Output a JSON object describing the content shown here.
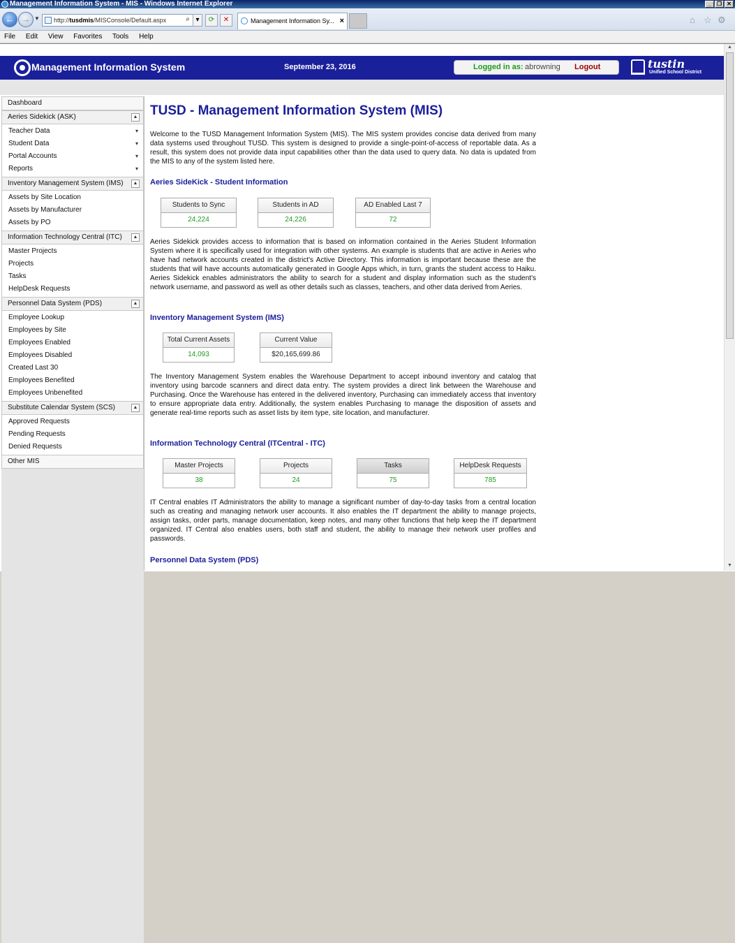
{
  "window": {
    "title": "Management Information System - MIS - Windows Internet Explorer",
    "url_prefix": "http://",
    "url_host": "tusdmis",
    "url_path": "/MISConsole/Default.aspx",
    "tab_title": "Management Information Sy...",
    "menu": [
      "File",
      "Edit",
      "View",
      "Favorites",
      "Tools",
      "Help"
    ]
  },
  "header": {
    "app_title": "Management Information System",
    "date": "September 23, 2016",
    "logged_in_label": "Logged in as:",
    "username": "abrowning",
    "logout": "Logout",
    "district_name": "tustin",
    "district_sub": "Unified School District"
  },
  "sidebar": {
    "dashboard": "Dashboard",
    "sections": [
      {
        "title": "Aeries Sidekick (ASK)",
        "items": [
          "Teacher Data",
          "Student Data",
          "Portal Accounts",
          "Reports"
        ]
      },
      {
        "title": "Inventory Management System (IMS)",
        "items": [
          "Assets by Site Location",
          "Assets by Manufacturer",
          "Assets by PO"
        ]
      },
      {
        "title": "Information Technology Central (ITC)",
        "items": [
          "Master Projects",
          "Projects",
          "Tasks",
          "HelpDesk Requests"
        ]
      },
      {
        "title": "Personnel Data System (PDS)",
        "items": [
          "Employee Lookup",
          "Employees by Site",
          "Employees Enabled",
          "Employees Disabled",
          "Created Last 30",
          "Employees Benefited",
          "Employees Unbenefited"
        ]
      },
      {
        "title": "Substitute Calendar System (SCS)",
        "items": [
          "Approved Requests",
          "Pending Requests",
          "Denied Requests"
        ]
      }
    ],
    "other": "Other MIS"
  },
  "main": {
    "title": "TUSD - Management Information System (MIS)",
    "intro": "Welcome to the TUSD Management Information System (MIS). The MIS system provides concise data derived from many data systems used throughout TUSD. This system is designed to provide a single-point-of-access of reportable data. As a result, this system does not provide data input capabilities other than the data used to query data. No data is updated from the MIS to any of the system listed here.",
    "ask": {
      "heading": "Aeries SideKick - Student Information",
      "stats": [
        {
          "label": "Students to Sync",
          "value": "24,224"
        },
        {
          "label": "Students in AD",
          "value": "24,226"
        },
        {
          "label": "AD Enabled Last 7",
          "value": "72"
        }
      ],
      "text": "Aeries Sidekick provides access to information that is based on information contained in the Aeries Student Information System where it is specifically used for integration with other systems. An example is students that are active in Aeries who have had network accounts created in the district's Active Directory. This information is important because these are the students that will have accounts automatically generated in Google Apps which, in turn, grants the student access to Haiku. Aeries Sidekick enables administrators the ability to search for a student and display information such as the student's network username, and password as well as other details such as classes, teachers, and other data derived from Aeries."
    },
    "ims": {
      "heading": "Inventory Management System (IMS)",
      "stats": [
        {
          "label": "Total Current Assets",
          "value": "14,093"
        },
        {
          "label": "Current Value",
          "value": "$20,165,699.86"
        }
      ],
      "text": "The Inventory Management System enables the Warehouse Department to accept inbound inventory and catalog that inventory using barcode scanners and direct data entry. The system provides a direct link between the Warehouse and Purchasing. Once the Warehouse has entered in the delivered inventory, Purchasing can immediately access that inventory to ensure appropriate data entry. Additionally, the system enables Purchasing to manage the disposition of assets and generate real-time reports such as asset lists by item type, site location, and manufacturer."
    },
    "itc": {
      "heading": "Information Technology Central (ITCentral - ITC)",
      "stats": [
        {
          "label": "Master Projects",
          "value": "38"
        },
        {
          "label": "Projects",
          "value": "24"
        },
        {
          "label": "Tasks",
          "value": "75"
        },
        {
          "label": "HelpDesk Requests",
          "value": "785"
        }
      ],
      "text": "IT Central enables IT Administrators the ability to manage a significant number of day-to-day tasks from a central location such as creating and managing network user accounts. It also enables the IT department the ability to manage projects, assign tasks, order parts, manage documentation, keep notes, and many other functions that help keep the IT department organized. IT Central also enables users, both staff and student, the ability to manage their network user profiles and passwords."
    },
    "pds": {
      "heading": "Personnel Data System (PDS)"
    }
  },
  "colors": {
    "header_bg": "#1a1f9a",
    "heading": "#1a1f9a",
    "stat_value": "#1e9b1e",
    "logout": "#9a0000"
  }
}
